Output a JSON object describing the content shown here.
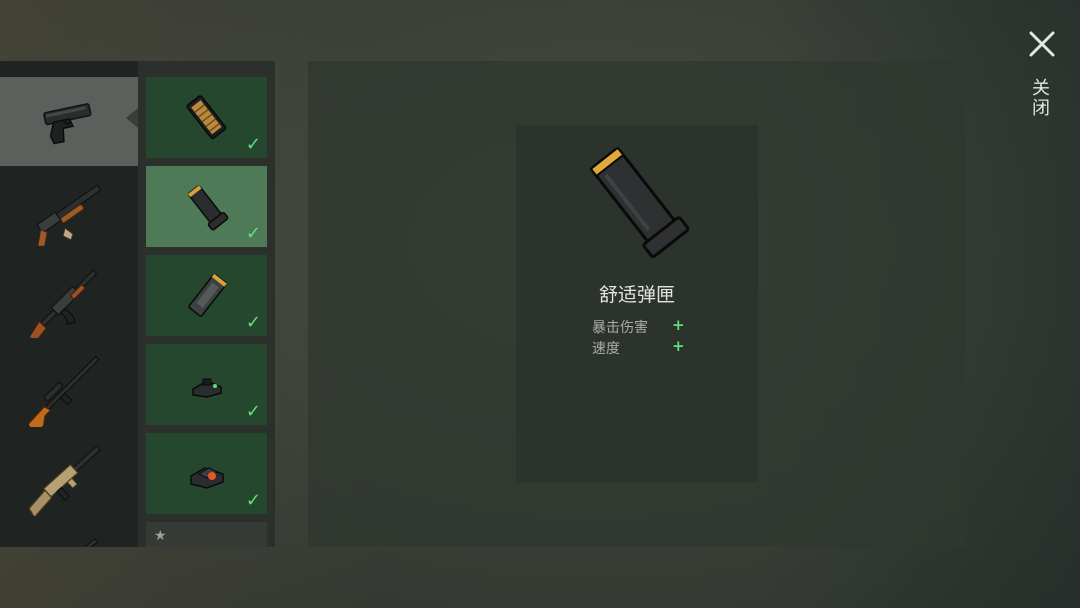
{
  "screen": "weapon-attachments",
  "close": {
    "label": "关闭",
    "icon": "close-icon"
  },
  "weapons": [
    {
      "name": "pistol-icon",
      "selected": true
    },
    {
      "name": "shotgun-icon",
      "selected": false
    },
    {
      "name": "assault-rifle-icon",
      "selected": false
    },
    {
      "name": "sniper-rifle-icon",
      "selected": false
    },
    {
      "name": "tan-rifle-icon",
      "selected": false
    },
    {
      "name": "rifle-icon",
      "selected": false
    }
  ],
  "attachments": [
    {
      "icon": "extended-magazine-icon",
      "owned": true,
      "active": false
    },
    {
      "icon": "comfort-magazine-icon",
      "owned": true,
      "active": true
    },
    {
      "icon": "standard-magazine-icon",
      "owned": true,
      "active": false
    },
    {
      "icon": "iron-sight-icon",
      "owned": true,
      "active": false
    },
    {
      "icon": "red-dot-sight-icon",
      "owned": true,
      "active": false
    },
    {
      "icon": "locked-attachment-icon",
      "owned": false,
      "active": false
    }
  ],
  "detail": {
    "name": "舒适弹匣",
    "stats": [
      {
        "label": "暴击伤害",
        "sign": "+"
      },
      {
        "label": "速度",
        "sign": "+"
      }
    ]
  },
  "colors": {
    "accent_green": "#5fe07c",
    "slot_green": "#24472e",
    "slot_selected": "#4f7a58"
  }
}
